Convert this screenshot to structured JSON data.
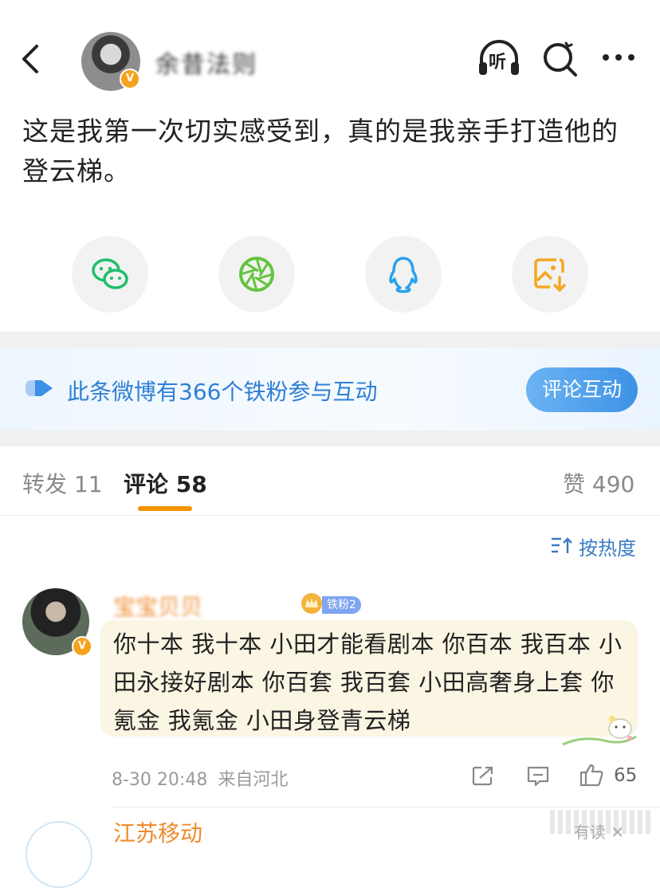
{
  "header": {
    "author_name": "余昔法则",
    "back_icon": "chevron-left-icon",
    "listen_label": "听",
    "search_icon": "search-icon",
    "more_icon": "more-icon",
    "verified_mark": "V"
  },
  "post": {
    "text": "这是我第一次切实感受到，真的是我亲手打造他的登云梯。"
  },
  "share": [
    {
      "name": "wechat",
      "icon": "wechat-icon",
      "color": "#1fbf6b"
    },
    {
      "name": "moments",
      "icon": "moments-icon",
      "color": "#62c43d"
    },
    {
      "name": "qq",
      "icon": "qq-icon",
      "color": "#2aa3e8"
    },
    {
      "name": "save-image",
      "icon": "save-image-icon",
      "color": "#f5a623"
    }
  ],
  "banner": {
    "text": "此条微博有366个铁粉参与互动",
    "button": "评论互动"
  },
  "tabs": {
    "repost": "转发 11",
    "comments": "评论 58",
    "likes": "赞 490"
  },
  "sort": {
    "label": "按热度"
  },
  "comments": [
    {
      "name": "宝宝贝贝",
      "fan_badge": "铁粉2",
      "text": "你十本 我十本 小田才能看剧本  你百本 我百本 小田永接好剧本  你百套 我百套 小田高奢身上套 你氪金 我氪金 小田身登青云梯",
      "time": "8-30 20:48",
      "source": "来自河北",
      "likes": "65",
      "verified_mark": "V"
    }
  ],
  "next_comment": {
    "name": "江苏移动",
    "fold_label": "有读 ✕"
  },
  "colors": {
    "accent": "#f39300",
    "link": "#2f7fd6",
    "name": "#f08a2c"
  }
}
